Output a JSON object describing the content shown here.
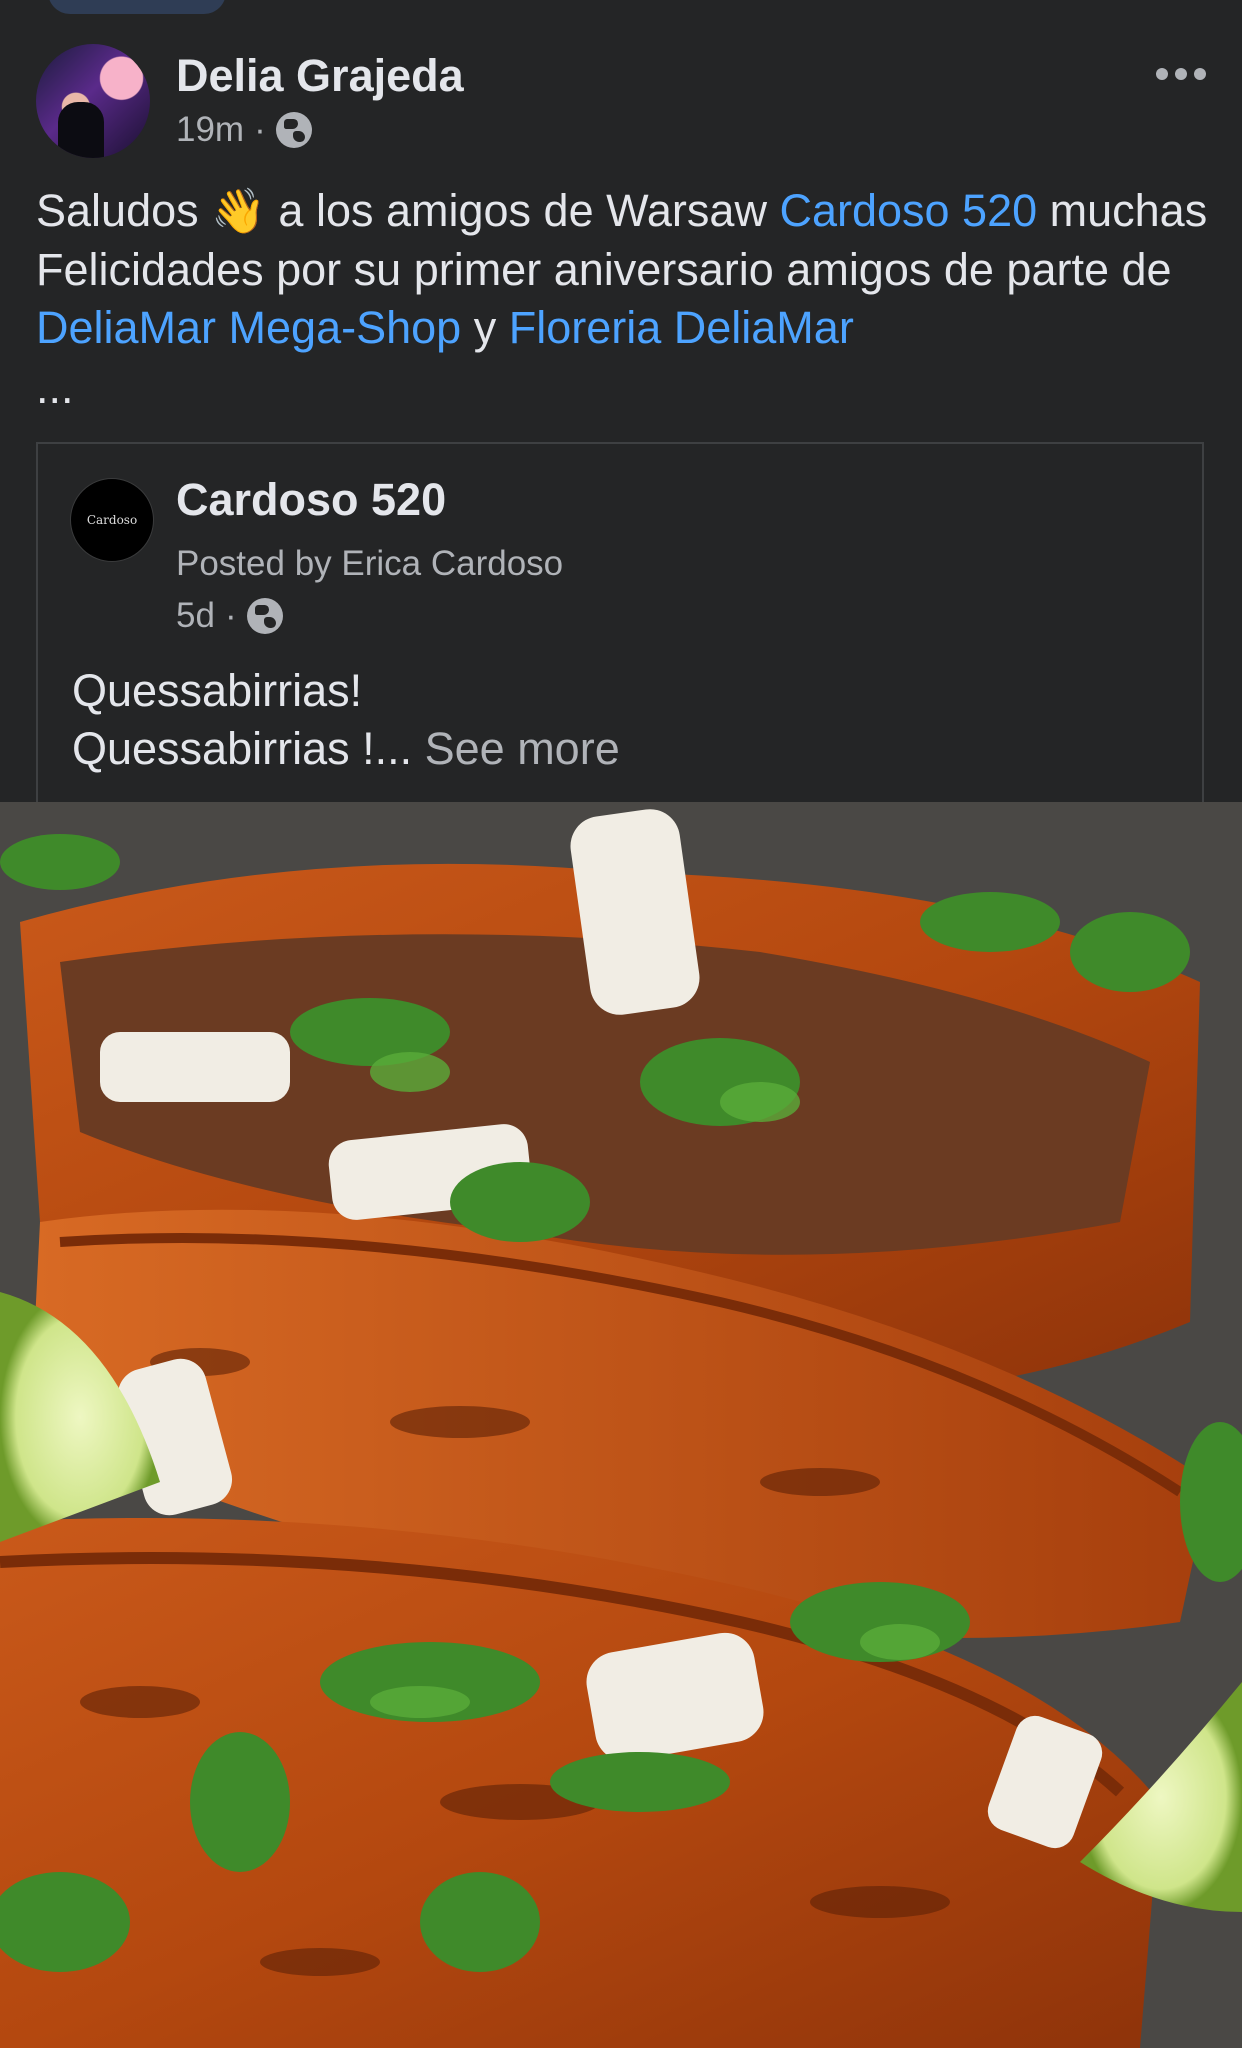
{
  "post": {
    "author": "Delia Grajeda",
    "time": "19m",
    "separator": "·",
    "text_start": "Saludos ",
    "emoji": "👋",
    "text_mid1": " a los amigos de Warsaw ",
    "link1": "Cardoso 520",
    "text_mid2": " muchas Felicidades por su primer aniversario amigos de parte de ",
    "link2": "DeliaMar Mega-Shop",
    "text_mid3": " y ",
    "link3": "Floreria DeliaMar",
    "truncation": "..."
  },
  "shared_post": {
    "page_name": "Cardoso 520",
    "avatar_text": "Cardoso",
    "posted_by": "Posted by Erica Cardoso",
    "time": "5d",
    "separator": "·",
    "line1": "Quessabirrias!",
    "line2": "Quessabirrias !...",
    "see_more": " See more"
  },
  "icons": {
    "more": "more-horizontal-icon",
    "privacy": "globe-icon"
  },
  "colors": {
    "background": "#242526",
    "link": "#4da3ff",
    "secondary_text": "#b0b3b8"
  }
}
